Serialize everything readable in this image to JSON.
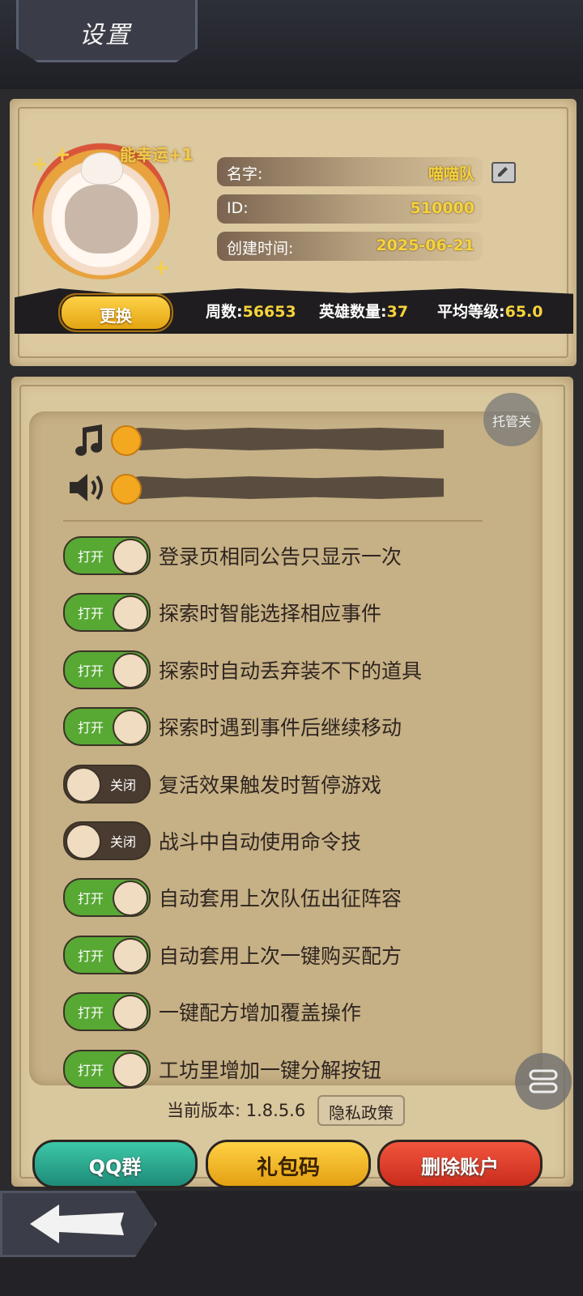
{
  "header": {
    "title": "设置"
  },
  "profile": {
    "badge": "能幸运+1",
    "name_label": "名字:",
    "name_value": "喵喵队",
    "id_label": "ID:",
    "id_value": "510000",
    "created_label": "创建时间:",
    "created_value": "2025-06-21",
    "change_label": "更换",
    "stats": {
      "weeks_label": "周数:",
      "weeks_value": "56653",
      "heroes_label": "英雄数量:",
      "heroes_value": "37",
      "avg_label": "平均等级:",
      "avg_value": "65.0"
    }
  },
  "autoplay": {
    "label": "托管关"
  },
  "audio": {
    "music_icon": "music-note-icon",
    "sound_icon": "speaker-icon",
    "music_level": 0,
    "sound_level": 0
  },
  "toggles": [
    {
      "state": "打开",
      "on": true,
      "label": "登录页相同公告只显示一次"
    },
    {
      "state": "打开",
      "on": true,
      "label": "探索时智能选择相应事件"
    },
    {
      "state": "打开",
      "on": true,
      "label": "探索时自动丢弃装不下的道具"
    },
    {
      "state": "打开",
      "on": true,
      "label": "探索时遇到事件后继续移动"
    },
    {
      "state": "关闭",
      "on": false,
      "label": "复活效果触发时暂停游戏"
    },
    {
      "state": "关闭",
      "on": false,
      "label": "战斗中自动使用命令技"
    },
    {
      "state": "打开",
      "on": true,
      "label": "自动套用上次队伍出征阵容"
    },
    {
      "state": "打开",
      "on": true,
      "label": "自动套用上次一键购买配方"
    },
    {
      "state": "打开",
      "on": true,
      "label": "一键配方增加覆盖操作"
    },
    {
      "state": "打开",
      "on": true,
      "label": "工坊里增加一键分解按钮"
    }
  ],
  "footer": {
    "version": "当前版本: 1.8.5.6",
    "privacy": "隐私政策",
    "qq_group": "QQ群",
    "gift_code": "礼包码",
    "delete_account": "删除账户"
  },
  "colors": {
    "toggle_on": "#58a834",
    "toggle_off": "#4a3b31",
    "accent_yellow": "#f6d33c",
    "parchment": "#d9c79d"
  }
}
